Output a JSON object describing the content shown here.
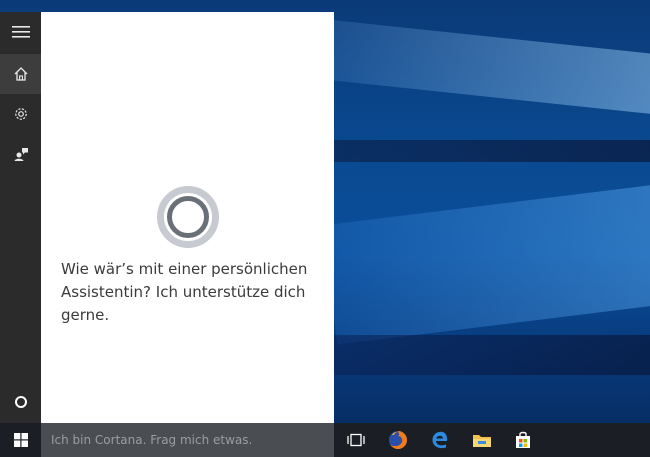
{
  "cortana": {
    "message": "Wie wär’s mit einer persönlichen Assistentin? Ich unterstütze dich gerne."
  },
  "rail": {
    "items": [
      {
        "icon": "hamburger-menu-icon"
      },
      {
        "icon": "home-icon",
        "active": true
      },
      {
        "icon": "gear-icon"
      },
      {
        "icon": "feedback-icon"
      }
    ],
    "bottom_icon": "cortana-circle-icon"
  },
  "taskbar": {
    "search_placeholder": "Ich bin Cortana. Frag mich etwas.",
    "icons": [
      "task-view-icon",
      "firefox-icon",
      "edge-icon",
      "file-explorer-icon",
      "store-icon"
    ]
  },
  "colors": {
    "rail_bg": "#2b2b2b",
    "panel_bg": "#ffffff",
    "taskbar_bg": "#1b1e24",
    "search_bg": "#4a4d52",
    "accent_blue": "#1e88e5"
  }
}
